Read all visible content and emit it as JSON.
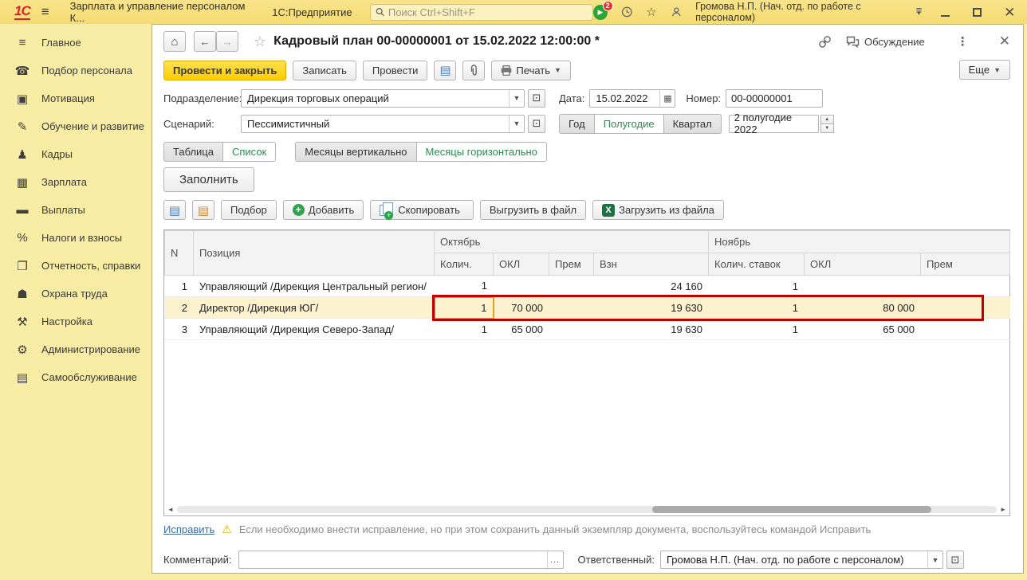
{
  "titlebar": {
    "logo": "1С",
    "app_title": "Зарплата и управление персоналом К...",
    "platform": "1С:Предприятие",
    "search_placeholder": "Поиск Ctrl+Shift+F",
    "notification_count": "2",
    "user": "Громова Н.П. (Нач. отд. по работе с персоналом)"
  },
  "sidebar": {
    "items": [
      {
        "icon": "menu-icon",
        "glyph": "≡",
        "label": "Главное"
      },
      {
        "icon": "phone-icon",
        "glyph": "☎",
        "label": "Подбор персонала"
      },
      {
        "icon": "gift-icon",
        "glyph": "▣",
        "label": "Мотивация"
      },
      {
        "icon": "education-icon",
        "glyph": "✎",
        "label": "Обучение и развитие"
      },
      {
        "icon": "people-icon",
        "glyph": "♟",
        "label": "Кадры"
      },
      {
        "icon": "calculator-icon",
        "glyph": "▦",
        "label": "Зарплата"
      },
      {
        "icon": "payment-card-icon",
        "glyph": "▬",
        "label": "Выплаты"
      },
      {
        "icon": "percent-icon",
        "glyph": "%",
        "label": "Налоги и взносы"
      },
      {
        "icon": "reports-icon",
        "glyph": "❐",
        "label": "Отчетность, справки"
      },
      {
        "icon": "helmet-icon",
        "glyph": "☗",
        "label": "Охрана труда"
      },
      {
        "icon": "wrench-icon",
        "glyph": "⚒",
        "label": "Настройка"
      },
      {
        "icon": "gear-icon",
        "glyph": "⚙",
        "label": "Администрирование"
      },
      {
        "icon": "id-card-icon",
        "glyph": "▤",
        "label": "Самообслуживание"
      }
    ]
  },
  "document": {
    "title": "Кадровый план 00-00000001 от 15.02.2022 12:00:00 *",
    "discussion_label": "Обсуждение",
    "actions": {
      "post_close": "Провести и закрыть",
      "save": "Записать",
      "post": "Провести",
      "print": "Печать",
      "more": "Еще"
    },
    "fields": {
      "department_label": "Подразделение:",
      "department_value": "Дирекция торговых операций",
      "date_label": "Дата:",
      "date_value": "15.02.2022",
      "number_label": "Номер:",
      "number_value": "00-00000001",
      "scenario_label": "Сценарий:",
      "scenario_value": "Пессимистичный",
      "period_buttons": [
        "Год",
        "Полугодие",
        "Квартал"
      ],
      "period_selected": "Полугодие",
      "period_value": "2 полугодие 2022"
    },
    "view_tabs": {
      "table": "Таблица",
      "list": "Список",
      "months_vertical": "Месяцы вертикально",
      "months_horizontal": "Месяцы горизонтально"
    },
    "fill_button": "Заполнить",
    "row_actions": {
      "pick": "Подбор",
      "add": "Добавить",
      "copy": "Скопировать",
      "export": "Выгрузить в файл",
      "import": "Загрузить из файла"
    }
  },
  "grid": {
    "month1": "Октябрь",
    "month2": "Ноябрь",
    "headers": {
      "n": "N",
      "position": "Позиция",
      "oct": [
        "Колич.",
        "ОКЛ",
        "Прем",
        "Взн"
      ],
      "nov": [
        "Колич. ставок",
        "ОКЛ",
        "Прем"
      ]
    },
    "rows": [
      {
        "n": "1",
        "position": "Управляющий /Дирекция Центральный регион/",
        "oct_qty": "1",
        "oct_okl": "",
        "oct_prem": "",
        "oct_vzn": "24 160",
        "nov_qty": "1",
        "nov_okl": "",
        "nov_prem": ""
      },
      {
        "n": "2",
        "position": "Директор /Дирекция ЮГ/",
        "oct_qty": "1",
        "oct_okl": "70 000",
        "oct_prem": "",
        "oct_vzn": "19 630",
        "nov_qty": "1",
        "nov_okl": "80 000",
        "nov_prem": ""
      },
      {
        "n": "3",
        "position": "Управляющий /Дирекция Северо-Запад/",
        "oct_qty": "1",
        "oct_okl": "65 000",
        "oct_prem": "",
        "oct_vzn": "19 630",
        "nov_qty": "1",
        "nov_okl": "65 000",
        "nov_prem": ""
      }
    ]
  },
  "footer": {
    "fix_link": "Исправить",
    "warning": "Если необходимо внести исправление, но при этом сохранить данный экземпляр документа, воспользуйтесь командой Исправить",
    "comment_label": "Комментарий:",
    "comment_value": "",
    "responsible_label": "Ответственный:",
    "responsible_value": "Громова Н.П. (Нач. отд. по работе с персоналом)"
  },
  "colors": {
    "accent_yellow": "#FFCC00",
    "selected_green": "#2E8B4F",
    "highlight_red": "#C00000",
    "row_highlight": "#FCF2CD",
    "link_blue": "#3A6EA5"
  }
}
